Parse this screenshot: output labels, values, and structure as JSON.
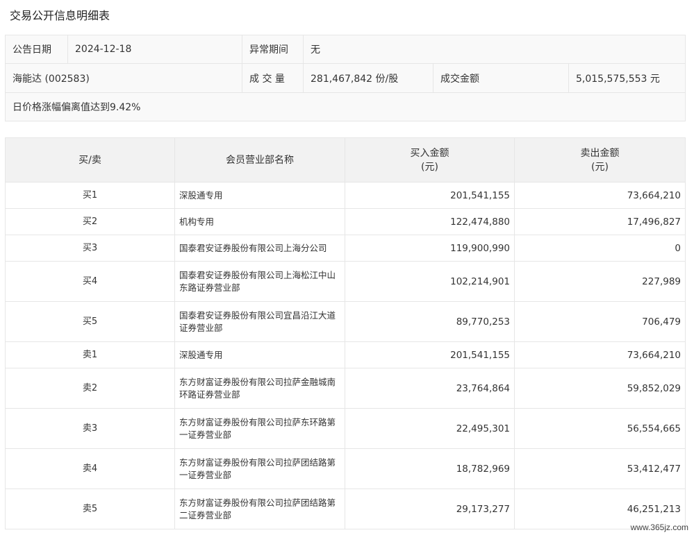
{
  "page": {
    "title": "交易公开信息明细表"
  },
  "info": {
    "date_label": "公告日期",
    "date_value": "2024-12-18",
    "abnormal_label": "异常期间",
    "abnormal_value": "无",
    "stock": "海能达 (002583)",
    "volume_label": "成 交 量",
    "volume_value": "281,467,842 份/股",
    "amount_label": "成交金额",
    "amount_value": "5,015,575,553 元",
    "reason": "日价格涨幅偏离值达到9.42%"
  },
  "table": {
    "headers": {
      "side": "买/卖",
      "branch": "会员营业部名称",
      "buy_line1": "买入金额",
      "buy_line2": "(元)",
      "sell_line1": "卖出金额",
      "sell_line2": "(元)"
    },
    "rows": [
      {
        "side": "买1",
        "branch": "深股通专用",
        "buy": "201,541,155",
        "sell": "73,664,210"
      },
      {
        "side": "买2",
        "branch": "机构专用",
        "buy": "122,474,880",
        "sell": "17,496,827"
      },
      {
        "side": "买3",
        "branch": "国泰君安证券股份有限公司上海分公司",
        "buy": "119,900,990",
        "sell": "0"
      },
      {
        "side": "买4",
        "branch": "国泰君安证券股份有限公司上海松江中山东路证券营业部",
        "buy": "102,214,901",
        "sell": "227,989"
      },
      {
        "side": "买5",
        "branch": "国泰君安证券股份有限公司宜昌沿江大道证券营业部",
        "buy": "89,770,253",
        "sell": "706,479"
      },
      {
        "side": "卖1",
        "branch": "深股通专用",
        "buy": "201,541,155",
        "sell": "73,664,210"
      },
      {
        "side": "卖2",
        "branch": "东方财富证券股份有限公司拉萨金融城南环路证券营业部",
        "buy": "23,764,864",
        "sell": "59,852,029"
      },
      {
        "side": "卖3",
        "branch": "东方财富证券股份有限公司拉萨东环路第一证券营业部",
        "buy": "22,495,301",
        "sell": "56,554,665"
      },
      {
        "side": "卖4",
        "branch": "东方财富证券股份有限公司拉萨团结路第一证券营业部",
        "buy": "18,782,969",
        "sell": "53,412,477"
      },
      {
        "side": "卖5",
        "branch": "东方财富证券股份有限公司拉萨团结路第二证券营业部",
        "buy": "29,173,277",
        "sell": "46,251,213"
      }
    ]
  },
  "watermark": "www.365jz.com"
}
